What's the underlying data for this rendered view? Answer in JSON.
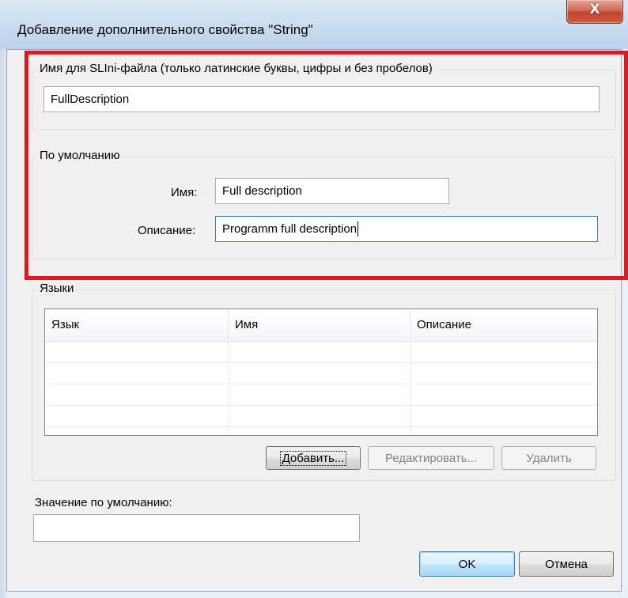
{
  "window": {
    "title": "Добавление дополнительного свойства \"String\"",
    "close_glyph": "X"
  },
  "ini_group": {
    "label": "Имя для SLIni-файла (только латинские буквы, цифры и без пробелов)",
    "value": "FullDescription"
  },
  "default_group": {
    "label": "По умолчанию",
    "name_label": "Имя:",
    "name_value": "Full description",
    "description_label": "Описание:",
    "description_value": "Programm full description"
  },
  "languages_group": {
    "label": "Языки",
    "columns": [
      "Язык",
      "Имя",
      "Описание"
    ],
    "rows": [],
    "add_button": "Добавить...",
    "edit_button": "Редактировать...",
    "delete_button": "Удалить"
  },
  "default_value": {
    "label": "Значение по умолчанию:",
    "value": ""
  },
  "footer": {
    "ok_button": "OK",
    "cancel_button": "Отмена"
  },
  "colors": {
    "highlight": "#e3151f",
    "dialog_bg": "#f0f0f0",
    "default_button_border": "#3c7fb1"
  }
}
